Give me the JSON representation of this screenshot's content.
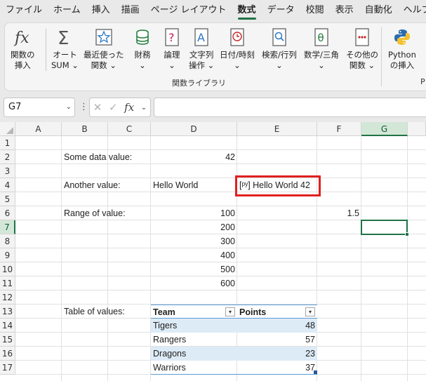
{
  "menu": {
    "items": [
      "ファイル",
      "ホーム",
      "挿入",
      "描画",
      "ページ レイアウト",
      "数式",
      "データ",
      "校閲",
      "表示",
      "自動化",
      "ヘルプ"
    ],
    "active_index": 5
  },
  "ribbon": {
    "insert_function": {
      "line1": "関数の",
      "line2": "挿入",
      "icon": "fx-icon"
    },
    "autosum": {
      "line1": "オート",
      "line2": "SUM ⌄",
      "icon": "sigma-icon"
    },
    "recently_used": {
      "line1": "最近使った",
      "line2": "関数 ⌄",
      "icon": "star-icon"
    },
    "financial": {
      "line1": "財務",
      "line2": "⌄",
      "icon": "coins-icon"
    },
    "logical": {
      "line1": "論理",
      "line2": "⌄",
      "icon": "question-icon"
    },
    "text": {
      "line1": "文字列",
      "line2": "操作 ⌄",
      "icon": "letter-a-icon"
    },
    "datetime": {
      "line1": "日付/時刻",
      "line2": "⌄",
      "icon": "clock-icon"
    },
    "lookup": {
      "line1": "検索/行列",
      "line2": "⌄",
      "icon": "magnifier-icon"
    },
    "math": {
      "line1": "数学/三角",
      "line2": "⌄",
      "icon": "theta-icon"
    },
    "more": {
      "line1": "その他の",
      "line2": "関数 ⌄",
      "icon": "dots-icon"
    },
    "python": {
      "line1": "Python",
      "line2": "の挿入",
      "icon": "python-icon"
    },
    "group_label": "関数ライブラリ",
    "next_group_partial": "P"
  },
  "formula_bar": {
    "name_box": "G7",
    "name_box_arrow": "⌄",
    "dots": "⋮",
    "cancel_glyph": "✕",
    "enter_glyph": "✓",
    "fx_glyph": "fx",
    "fx_arrow": "⌄",
    "formula": ""
  },
  "grid": {
    "columns": [
      "A",
      "B",
      "C",
      "D",
      "E",
      "F",
      "G"
    ],
    "rows": [
      "1",
      "2",
      "3",
      "4",
      "5",
      "6",
      "7",
      "8",
      "9",
      "10",
      "11",
      "12",
      "13",
      "14",
      "15",
      "16",
      "17"
    ],
    "selected_column": "G",
    "selected_row": "7",
    "cells": {
      "b2": "Some data value:",
      "d2": "42",
      "b4": "Another value:",
      "d4": "Hello World",
      "e4": "[ᵖʸ] Hello World 42",
      "b6": "Range of value:",
      "d6": "100",
      "f6": "1.5",
      "d7": "200",
      "d8": "300",
      "d9": "400",
      "d10": "500",
      "d11": "600",
      "b13": "Table of values:"
    },
    "table": {
      "headers": [
        "Team",
        "Points"
      ],
      "filter_glyph": "▾",
      "rows": [
        {
          "team": "Tigers",
          "points": "48"
        },
        {
          "team": "Rangers",
          "points": "57"
        },
        {
          "team": "Dragons",
          "points": "23"
        },
        {
          "team": "Warriors",
          "points": "37"
        }
      ]
    },
    "colors": {
      "accent": "#217346",
      "highlight_box": "#e02020",
      "table_band": "#ddebf7",
      "table_border": "#5b9bd5"
    }
  }
}
